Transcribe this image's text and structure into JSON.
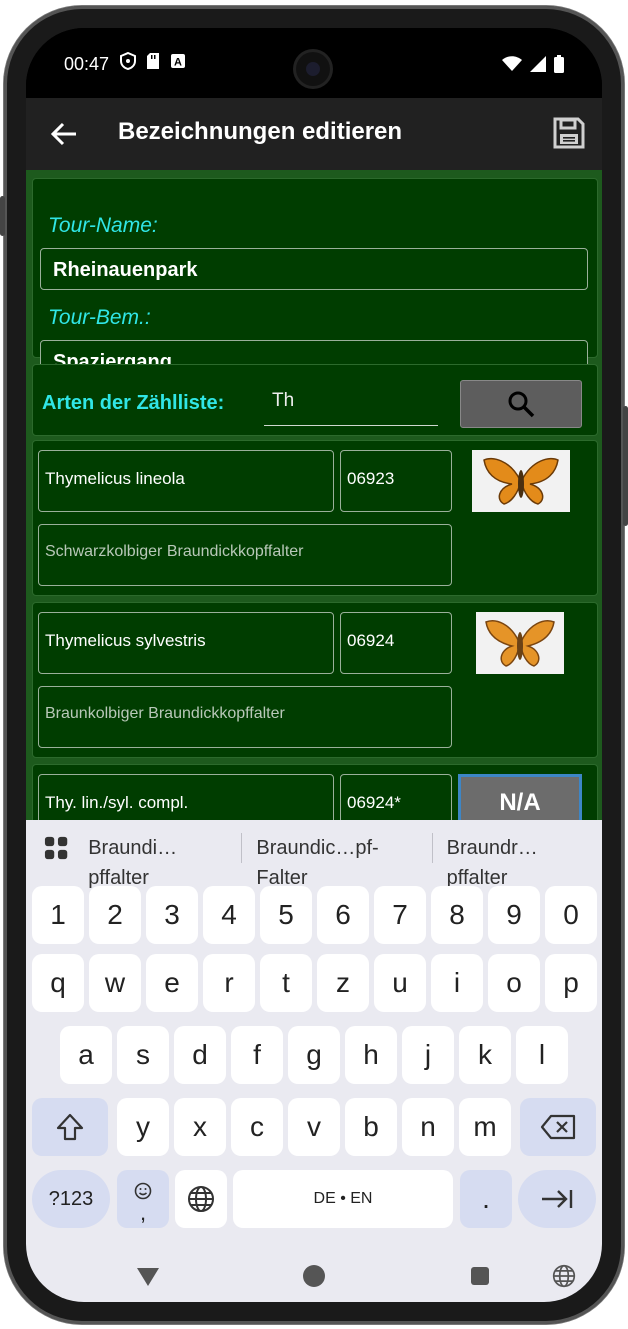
{
  "status": {
    "time": "00:47"
  },
  "appbar": {
    "title": "Bezeichnungen editieren"
  },
  "tour": {
    "name_label": "Tour-Name:",
    "name_value": "Rheinauenpark",
    "bem_label": "Tour-Bem.:",
    "bem_value": "Spaziergang"
  },
  "search": {
    "label": "Arten der Zählliste:",
    "value": "Th"
  },
  "species": [
    {
      "scientific": "Thymelicus lineola",
      "code": "06923",
      "common": "Schwarzkolbiger Braundickkopffalter"
    },
    {
      "scientific": "Thymelicus sylvestris",
      "code": "06924",
      "common": "Braunkolbiger Braundickkopffalter"
    },
    {
      "scientific": "Thy. lin./syl. compl.",
      "code": "06924*",
      "image_label": "N/A"
    }
  ],
  "keyboard": {
    "suggestions": [
      "Braundi…pffalter",
      "Braundic…pf-Falter",
      "Braundr…pffalter"
    ],
    "row_numbers": [
      "1",
      "2",
      "3",
      "4",
      "5",
      "6",
      "7",
      "8",
      "9",
      "0"
    ],
    "row_1": [
      "q",
      "w",
      "e",
      "r",
      "t",
      "z",
      "u",
      "i",
      "o",
      "p"
    ],
    "row_2": [
      "a",
      "s",
      "d",
      "f",
      "g",
      "h",
      "j",
      "k",
      "l"
    ],
    "row_3": [
      "y",
      "x",
      "c",
      "v",
      "b",
      "n",
      "m"
    ],
    "symbols_key": "?123",
    "emoji_comma": ",",
    "space_label": "DE • EN",
    "period_key": "."
  },
  "colors": {
    "background_green": "#1d5a1d",
    "panel_green": "#003d00",
    "label_cyan": "#30e6e6",
    "appbar": "#212121"
  }
}
